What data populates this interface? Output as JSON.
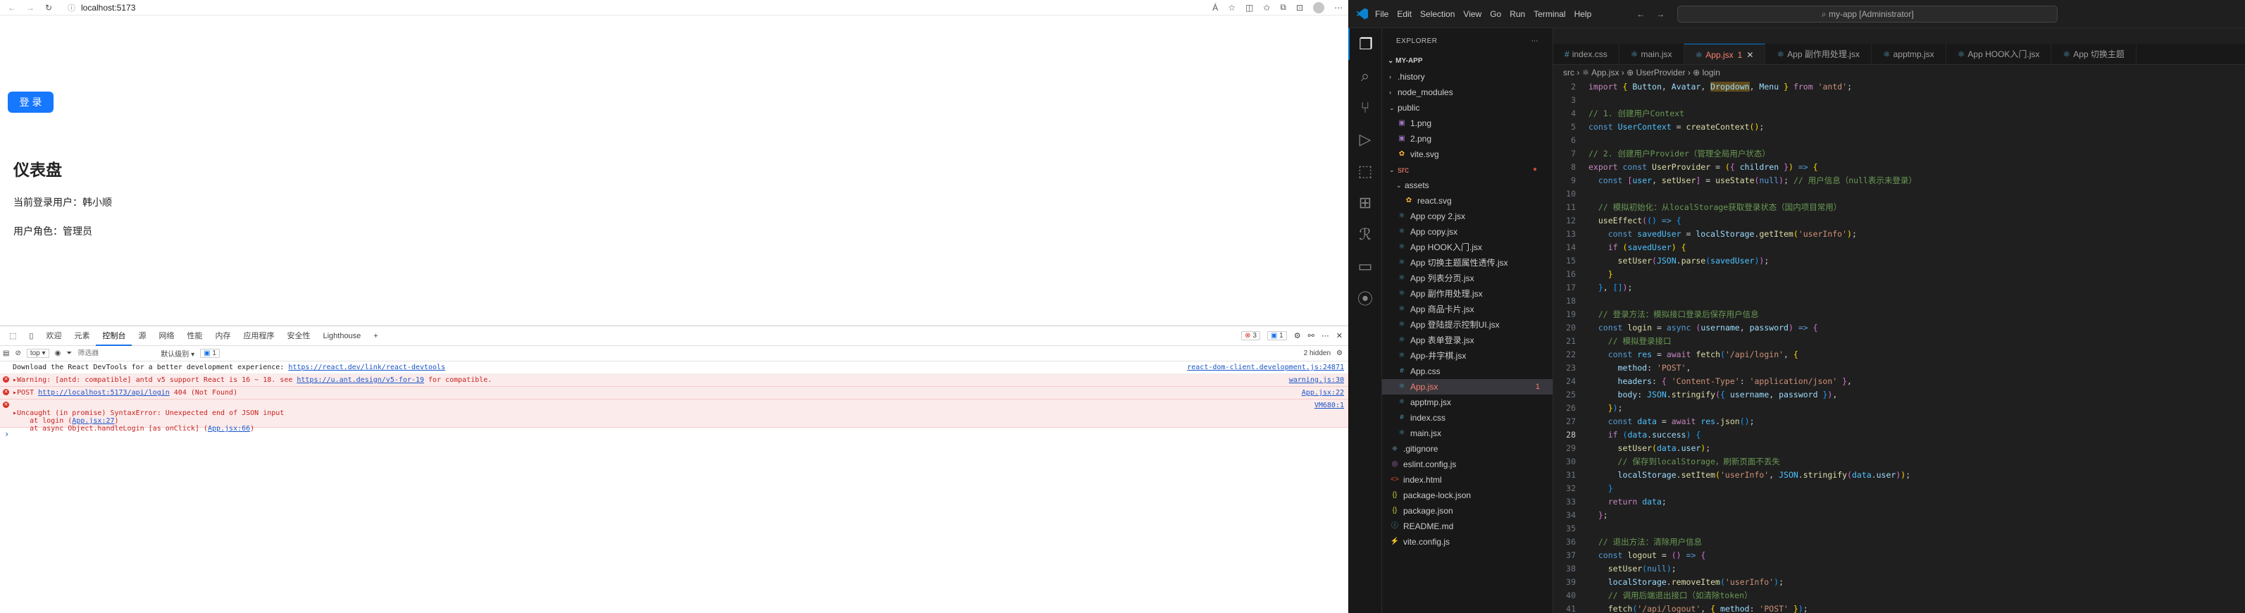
{
  "browser": {
    "url": "localhost:5173",
    "toolbar_a_icon": "Á",
    "page": {
      "login_button": "登 录",
      "heading": "仪表盘",
      "current_user": "当前登录用户：韩小顺",
      "user_role": "用户角色：管理员"
    }
  },
  "devtools": {
    "tabs": [
      "欢迎",
      "元素",
      "控制台",
      "源",
      "网络",
      "性能",
      "内存",
      "应用程序",
      "安全性",
      "Lighthouse"
    ],
    "error_count": "3",
    "info_count": "1",
    "context": "top",
    "filter_placeholder": "筛选器",
    "level": "默认级别",
    "issues_count": "1",
    "hidden": "2 hidden",
    "messages": [
      {
        "type": "info",
        "text": "Download the React DevTools for a better development experience: ",
        "link": "https://react.dev/link/react-devtools",
        "source": "react-dom-client.development.js:24871"
      },
      {
        "type": "error",
        "text": "▸Warning: [antd: compatible] antd v5 support React is 16 ~ 18. see ",
        "link": "https://u.ant.design/v5-for-19",
        "tail": " for compatible.",
        "source": "warning.js:30"
      },
      {
        "type": "error",
        "text": "▸POST ",
        "link": "http://localhost:5173/api/login",
        "tail": " 404 (Not Found)",
        "source": "App.jsx:22"
      },
      {
        "type": "error",
        "text": "▸Uncaught (in promise) SyntaxError: Unexpected end of JSON input",
        "line2": "    at login (",
        "line2link": "App.jsx:27",
        "line2tail": ")",
        "line3": "    at async Object.handleLogin [as onClick] (",
        "line3link": "App.jsx:66",
        "line3tail": ")",
        "source": "VM680:1"
      }
    ]
  },
  "vscode": {
    "menu": [
      "File",
      "Edit",
      "Selection",
      "View",
      "Go",
      "Run",
      "Terminal",
      "Help"
    ],
    "search": "my-app [Administrator]",
    "tabs": [
      {
        "icon": "#",
        "label": "index.css",
        "active": false
      },
      {
        "icon": "⚛",
        "label": "main.jsx",
        "active": false
      },
      {
        "icon": "⚛",
        "label": "App.jsx",
        "active": true,
        "badge": "1"
      },
      {
        "icon": "⚛",
        "label": "App 副作用处理.jsx",
        "active": false
      },
      {
        "icon": "⚛",
        "label": "apptmp.jsx",
        "active": false
      },
      {
        "icon": "⚛",
        "label": "App HOOK入门.jsx",
        "active": false
      },
      {
        "icon": "⚛",
        "label": "App 切换主题",
        "active": false
      }
    ],
    "explorer_title": "EXPLORER",
    "project": "MY-APP",
    "tree": [
      {
        "label": ".history",
        "indent": 1,
        "type": "folder-closed"
      },
      {
        "label": "node_modules",
        "indent": 1,
        "type": "folder-closed"
      },
      {
        "label": "public",
        "indent": 1,
        "type": "folder-open"
      },
      {
        "label": "1.png",
        "indent": 2,
        "type": "img"
      },
      {
        "label": "2.png",
        "indent": 2,
        "type": "img"
      },
      {
        "label": "vite.svg",
        "indent": 2,
        "type": "svg"
      },
      {
        "label": "src",
        "indent": 1,
        "type": "folder-open",
        "err": true,
        "dot": "●"
      },
      {
        "label": "assets",
        "indent": 2,
        "type": "folder-open"
      },
      {
        "label": "react.svg",
        "indent": 3,
        "type": "svg"
      },
      {
        "label": "App copy 2.jsx",
        "indent": 2,
        "type": "jsx"
      },
      {
        "label": "App copy.jsx",
        "indent": 2,
        "type": "jsx"
      },
      {
        "label": "App HOOK入门.jsx",
        "indent": 2,
        "type": "jsx"
      },
      {
        "label": "App 切换主题属性透传.jsx",
        "indent": 2,
        "type": "jsx"
      },
      {
        "label": "App 列表分页.jsx",
        "indent": 2,
        "type": "jsx"
      },
      {
        "label": "App 副作用处理.jsx",
        "indent": 2,
        "type": "jsx"
      },
      {
        "label": "App 商品卡片.jsx",
        "indent": 2,
        "type": "jsx"
      },
      {
        "label": "App 登陆提示控制UI.jsx",
        "indent": 2,
        "type": "jsx"
      },
      {
        "label": "App 表单登录.jsx",
        "indent": 2,
        "type": "jsx"
      },
      {
        "label": "App-井字棋.jsx",
        "indent": 2,
        "type": "jsx"
      },
      {
        "label": "App.css",
        "indent": 2,
        "type": "css"
      },
      {
        "label": "App.jsx",
        "indent": 2,
        "type": "jsx",
        "err": true,
        "sel": true,
        "count": "1"
      },
      {
        "label": "apptmp.jsx",
        "indent": 2,
        "type": "jsx"
      },
      {
        "label": "index.css",
        "indent": 2,
        "type": "css"
      },
      {
        "label": "main.jsx",
        "indent": 2,
        "type": "jsx"
      },
      {
        "label": ".gitignore",
        "indent": 1,
        "type": "git"
      },
      {
        "label": "eslint.config.js",
        "indent": 1,
        "type": "eslint"
      },
      {
        "label": "index.html",
        "indent": 1,
        "type": "html"
      },
      {
        "label": "package-lock.json",
        "indent": 1,
        "type": "json"
      },
      {
        "label": "package.json",
        "indent": 1,
        "type": "json"
      },
      {
        "label": "README.md",
        "indent": 1,
        "type": "md"
      },
      {
        "label": "vite.config.js",
        "indent": 1,
        "type": "vite"
      }
    ],
    "breadcrumb": "src › ⚛ App.jsx › ⊕ UserProvider › ⊕ login",
    "current_line": 28,
    "code": [
      {
        "n": 2,
        "html": "<span class='kw2'>import</span> <span class='brc'>{</span> <span class='var'>Button</span>, <span class='var'>Avatar</span>, <span class='var hl'>Dropdown</span>, <span class='var'>Menu</span> <span class='brc'>}</span> <span class='kw2'>from</span> <span class='str'>'antd'</span>;"
      },
      {
        "n": 3,
        "html": ""
      },
      {
        "n": 4,
        "html": "<span class='cmt'>// 1. 创建用户Context</span>"
      },
      {
        "n": 5,
        "html": "<span class='kw'>const</span> <span class='cn'>UserContext</span> = <span class='fn'>createContext</span><span class='brc'>()</span>;"
      },
      {
        "n": 6,
        "html": ""
      },
      {
        "n": 7,
        "html": "<span class='cmt'>// 2. 创建用户Provider（管理全局用户状态）</span>"
      },
      {
        "n": 8,
        "html": "<span class='kw2'>export</span> <span class='kw'>const</span> <span class='fn'>UserProvider</span> = <span class='brc'>(</span><span class='brc2'>{</span> <span class='var'>children</span> <span class='brc2'>}</span><span class='brc'>)</span> <span class='kw'>=&gt;</span> <span class='brc'>{</span>"
      },
      {
        "n": 9,
        "html": "  <span class='kw'>const</span> <span class='brc2'>[</span><span class='cn'>user</span>, <span class='fn'>setUser</span><span class='brc2'>]</span> = <span class='fn'>useState</span><span class='brc2'>(</span><span class='kw'>null</span><span class='brc2'>)</span>; <span class='cmt'>// 用户信息（null表示未登录）</span>"
      },
      {
        "n": 10,
        "html": ""
      },
      {
        "n": 11,
        "html": "  <span class='cmt'>// 模拟初始化：从localStorage获取登录状态（国内项目常用）</span>"
      },
      {
        "n": 12,
        "html": "  <span class='fn'>useEffect</span><span class='brc2'>(</span><span class='brc3'>()</span> <span class='kw'>=&gt;</span> <span class='brc3'>{</span>"
      },
      {
        "n": 13,
        "html": "    <span class='kw'>const</span> <span class='cn'>savedUser</span> = <span class='var'>localStorage</span>.<span class='fn'>getItem</span><span class='brc'>(</span><span class='str'>'userInfo'</span><span class='brc'>)</span>;"
      },
      {
        "n": 14,
        "html": "    <span class='kw2'>if</span> <span class='brc'>(</span><span class='cn'>savedUser</span><span class='brc'>)</span> <span class='brc'>{</span>"
      },
      {
        "n": 15,
        "html": "      <span class='fn'>setUser</span><span class='brc2'>(</span><span class='cn'>JSON</span>.<span class='fn'>parse</span><span class='brc3'>(</span><span class='cn'>savedUser</span><span class='brc3'>)</span><span class='brc2'>)</span>;"
      },
      {
        "n": 16,
        "html": "    <span class='brc'>}</span>"
      },
      {
        "n": 17,
        "html": "  <span class='brc3'>}</span>, <span class='brc3'>[]</span><span class='brc2'>)</span>;"
      },
      {
        "n": 18,
        "html": ""
      },
      {
        "n": 19,
        "html": "  <span class='cmt'>// 登录方法：模拟接口登录后保存用户信息</span>"
      },
      {
        "n": 20,
        "html": "  <span class='kw'>const</span> <span class='fn'>login</span> = <span class='kw'>async</span> <span class='brc2'>(</span><span class='var'>username</span>, <span class='var'>password</span><span class='brc2'>)</span> <span class='kw'>=&gt;</span> <span class='brc2'>{</span>"
      },
      {
        "n": 21,
        "html": "    <span class='cmt'>// 模拟登录接口</span>"
      },
      {
        "n": 22,
        "html": "    <span class='kw'>const</span> <span class='cn'>res</span> = <span class='kw2'>await</span> <span class='fn'>fetch</span><span class='brc3'>(</span><span class='str'>'/api/login'</span>, <span class='brc'>{</span>"
      },
      {
        "n": 23,
        "html": "      <span class='var'>method</span>: <span class='str'>'POST'</span>,"
      },
      {
        "n": 24,
        "html": "      <span class='var'>headers</span>: <span class='brc2'>{</span> <span class='str'>'Content-Type'</span>: <span class='str'>'application/json'</span> <span class='brc2'>}</span>,"
      },
      {
        "n": 25,
        "html": "      <span class='var'>body</span>: <span class='cn'>JSON</span>.<span class='fn'>stringify</span><span class='brc2'>(</span><span class='brc3'>{</span> <span class='var'>username</span>, <span class='var'>password</span> <span class='brc3'>}</span><span class='brc2'>)</span>,"
      },
      {
        "n": 26,
        "html": "    <span class='brc'>}</span><span class='brc3'>)</span>;"
      },
      {
        "n": 27,
        "html": "    <span class='kw'>const</span> <span class='cn'>data</span> = <span class='kw2'>await</span> <span class='cn'>res</span>.<span class='fn'>json</span><span class='brc3'>()</span>;"
      },
      {
        "n": 28,
        "html": "    <span class='kw2'>if</span> <span class='brc3'>(</span><span class='cn'>data</span>.<span class='var'>success</span><span class='brc3'>)</span> <span class='brc3'>{</span>"
      },
      {
        "n": 29,
        "html": "      <span class='fn'>setUser</span><span class='brc'>(</span><span class='cn'>data</span>.<span class='var'>user</span><span class='brc'>)</span>;"
      },
      {
        "n": 30,
        "html": "      <span class='cmt'>// 保存到localStorage，刷新页面不丢失</span>"
      },
      {
        "n": 31,
        "html": "      <span class='var'>localStorage</span>.<span class='fn'>setItem</span><span class='brc'>(</span><span class='str'>'userInfo'</span>, <span class='cn'>JSON</span>.<span class='fn'>stringify</span><span class='brc2'>(</span><span class='cn'>data</span>.<span class='var'>user</span><span class='brc2'>)</span><span class='brc'>)</span>;"
      },
      {
        "n": 32,
        "html": "    <span class='brc3'>}</span>"
      },
      {
        "n": 33,
        "html": "    <span class='kw2'>return</span> <span class='cn'>data</span>;"
      },
      {
        "n": 34,
        "html": "  <span class='brc2'>}</span>;"
      },
      {
        "n": 35,
        "html": ""
      },
      {
        "n": 36,
        "html": "  <span class='cmt'>// 退出方法：清除用户信息</span>"
      },
      {
        "n": 37,
        "html": "  <span class='kw'>const</span> <span class='fn'>logout</span> = <span class='brc2'>()</span> <span class='kw'>=&gt;</span> <span class='brc2'>{</span>"
      },
      {
        "n": 38,
        "html": "    <span class='fn'>setUser</span><span class='brc3'>(</span><span class='kw'>null</span><span class='brc3'>)</span>;"
      },
      {
        "n": 39,
        "html": "    <span class='var'>localStorage</span>.<span class='fn'>removeItem</span><span class='brc3'>(</span><span class='str'>'userInfo'</span><span class='brc3'>)</span>;"
      },
      {
        "n": 40,
        "html": "    <span class='cmt'>// 调用后端退出接口（如清除token）</span>"
      },
      {
        "n": 41,
        "html": "    <span class='fn'>fetch</span><span class='brc3'>(</span><span class='str'>'/api/logout'</span>, <span class='brc'>{</span> <span class='var'>method</span>: <span class='str'>'POST'</span> <span class='brc'>}</span><span class='brc3'>)</span>;"
      }
    ]
  }
}
